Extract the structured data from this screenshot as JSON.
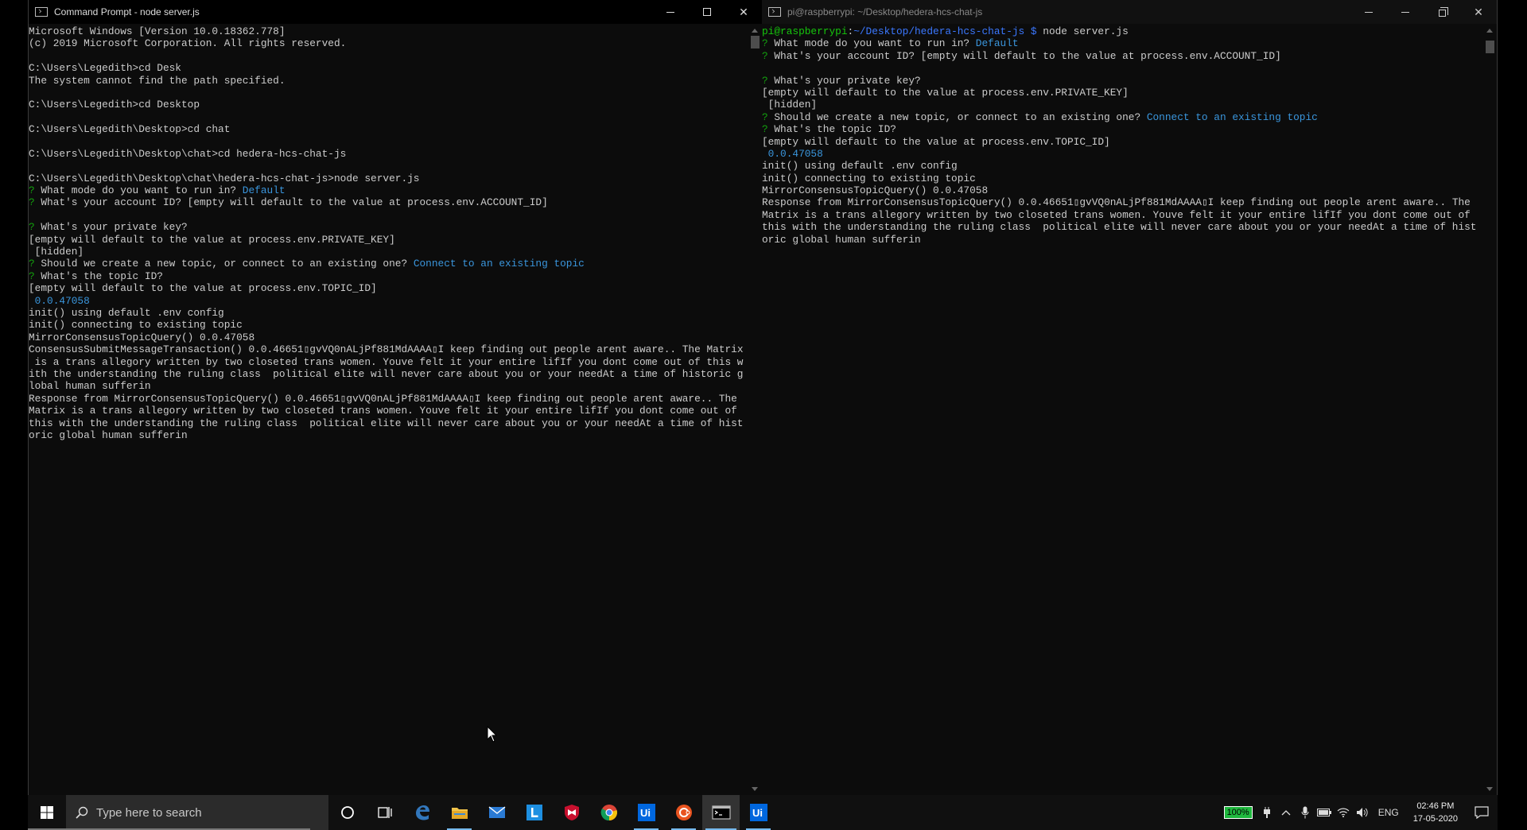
{
  "left_window": {
    "title": "Command Prompt - node  server.js",
    "lines": [
      [
        {
          "t": "Microsoft Windows [Version 10.0.18362.778]"
        }
      ],
      [
        {
          "t": "(c) 2019 Microsoft Corporation. All rights reserved."
        }
      ],
      [
        {
          "t": ""
        }
      ],
      [
        {
          "t": "C:\\Users\\Legedith>cd Desk"
        }
      ],
      [
        {
          "t": "The system cannot find the path specified."
        }
      ],
      [
        {
          "t": ""
        }
      ],
      [
        {
          "t": "C:\\Users\\Legedith>cd Desktop"
        }
      ],
      [
        {
          "t": ""
        }
      ],
      [
        {
          "t": "C:\\Users\\Legedith\\Desktop>cd chat"
        }
      ],
      [
        {
          "t": ""
        }
      ],
      [
        {
          "t": "C:\\Users\\Legedith\\Desktop\\chat>cd hedera-hcs-chat-js"
        }
      ],
      [
        {
          "t": ""
        }
      ],
      [
        {
          "t": "C:\\Users\\Legedith\\Desktop\\chat\\hedera-hcs-chat-js>node server.js"
        }
      ],
      [
        {
          "t": "?",
          "c": "q"
        },
        {
          "t": " What mode do you want to run in? "
        },
        {
          "t": "Default",
          "c": "cyan"
        }
      ],
      [
        {
          "t": "?",
          "c": "q"
        },
        {
          "t": " What's your account ID? [empty will default to the value at process.env.ACCOUNT_ID]"
        }
      ],
      [
        {
          "t": ""
        }
      ],
      [
        {
          "t": "?",
          "c": "q"
        },
        {
          "t": " What's your private key?"
        }
      ],
      [
        {
          "t": "[empty will default to the value at process.env.PRIVATE_KEY]"
        }
      ],
      [
        {
          "t": " [hidden]"
        }
      ],
      [
        {
          "t": "?",
          "c": "q"
        },
        {
          "t": " Should we create a new topic, or connect to an existing one? "
        },
        {
          "t": "Connect to an existing topic",
          "c": "cyan"
        }
      ],
      [
        {
          "t": "?",
          "c": "q"
        },
        {
          "t": " What's the topic ID?"
        }
      ],
      [
        {
          "t": "[empty will default to the value at process.env.TOPIC_ID]"
        }
      ],
      [
        {
          "t": " 0.0.47058",
          "c": "cyan"
        }
      ],
      [
        {
          "t": "init() using default .env config"
        }
      ],
      [
        {
          "t": "init() connecting to existing topic"
        }
      ],
      [
        {
          "t": "MirrorConsensusTopicQuery() 0.0.47058"
        }
      ],
      [
        {
          "t": "ConsensusSubmitMessageTransaction() 0.0.46651▯gvVQ0nALjPf881MdAAAA▯I keep finding out people arent aware.. The Matrix"
        }
      ],
      [
        {
          "t": " is a trans allegory written by two closeted trans women. Youve felt it your entire lifIf you dont come out of this w"
        }
      ],
      [
        {
          "t": "ith the understanding the ruling class  political elite will never care about you or your needAt a time of historic g"
        }
      ],
      [
        {
          "t": "lobal human sufferin"
        }
      ],
      [
        {
          "t": "Response from MirrorConsensusTopicQuery() 0.0.46651▯gvVQ0nALjPf881MdAAAA▯I keep finding out people arent aware.. The"
        }
      ],
      [
        {
          "t": "Matrix is a trans allegory written by two closeted trans women. Youve felt it your entire lifIf you dont come out of"
        }
      ],
      [
        {
          "t": "this with the understanding the ruling class  political elite will never care about you or your needAt a time of hist"
        }
      ],
      [
        {
          "t": "oric global human sufferin"
        }
      ]
    ]
  },
  "right_window": {
    "title": "pi@raspberrypi: ~/Desktop/hedera-hcs-chat-js",
    "lines": [
      [
        {
          "t": "pi@raspberrypi",
          "c": "green"
        },
        {
          "t": ":"
        },
        {
          "t": "~/Desktop/hedera-hcs-chat-js $",
          "c": "blue"
        },
        {
          "t": " node server.js"
        }
      ],
      [
        {
          "t": "?",
          "c": "q"
        },
        {
          "t": " What mode do you want to run in? "
        },
        {
          "t": "Default",
          "c": "cyan"
        }
      ],
      [
        {
          "t": "?",
          "c": "q"
        },
        {
          "t": " What's your account ID? [empty will default to the value at process.env.ACCOUNT_ID]"
        }
      ],
      [
        {
          "t": ""
        }
      ],
      [
        {
          "t": "?",
          "c": "q"
        },
        {
          "t": " What's your private key?"
        }
      ],
      [
        {
          "t": "[empty will default to the value at process.env.PRIVATE_KEY]"
        }
      ],
      [
        {
          "t": " [hidden]"
        }
      ],
      [
        {
          "t": "?",
          "c": "q"
        },
        {
          "t": " Should we create a new topic, or connect to an existing one? "
        },
        {
          "t": "Connect to an existing topic",
          "c": "cyan"
        }
      ],
      [
        {
          "t": "?",
          "c": "q"
        },
        {
          "t": " What's the topic ID?"
        }
      ],
      [
        {
          "t": "[empty will default to the value at process.env.TOPIC_ID]"
        }
      ],
      [
        {
          "t": " 0.0.47058",
          "c": "cyan"
        }
      ],
      [
        {
          "t": "init() using default .env config"
        }
      ],
      [
        {
          "t": "init() connecting to existing topic"
        }
      ],
      [
        {
          "t": "MirrorConsensusTopicQuery() 0.0.47058"
        }
      ],
      [
        {
          "t": "Response from MirrorConsensusTopicQuery() 0.0.46651▯gvVQ0nALjPf881MdAAAA▯I keep finding out people arent aware.. The"
        }
      ],
      [
        {
          "t": "Matrix is a trans allegory written by two closeted trans women. Youve felt it your entire lifIf you dont come out of"
        }
      ],
      [
        {
          "t": "this with the understanding the ruling class  political elite will never care about you or your needAt a time of hist"
        }
      ],
      [
        {
          "t": "oric global human sufferin"
        }
      ]
    ]
  },
  "taskbar": {
    "search_placeholder": "Type here to search",
    "apps": [
      "cortana-icon",
      "task-view-icon",
      "edge-icon",
      "file-explorer-icon",
      "mail-icon",
      "l-app-icon",
      "mcafee-icon",
      "chrome-icon",
      "uipath-icon",
      "ubuntu-app-icon",
      "terminal-icon",
      "uipath-icon"
    ],
    "battery_badge": "100%",
    "language": "ENG",
    "time": "02:46 PM",
    "date": "17-05-2020"
  },
  "colors": {
    "console_bg": "#0c0c0c",
    "console_text": "#cccccc",
    "prompt_question": "#13a10e",
    "answer_cyan": "#3a96dd",
    "pi_user_green": "#16c60c",
    "pi_path_blue": "#3b78ff"
  }
}
